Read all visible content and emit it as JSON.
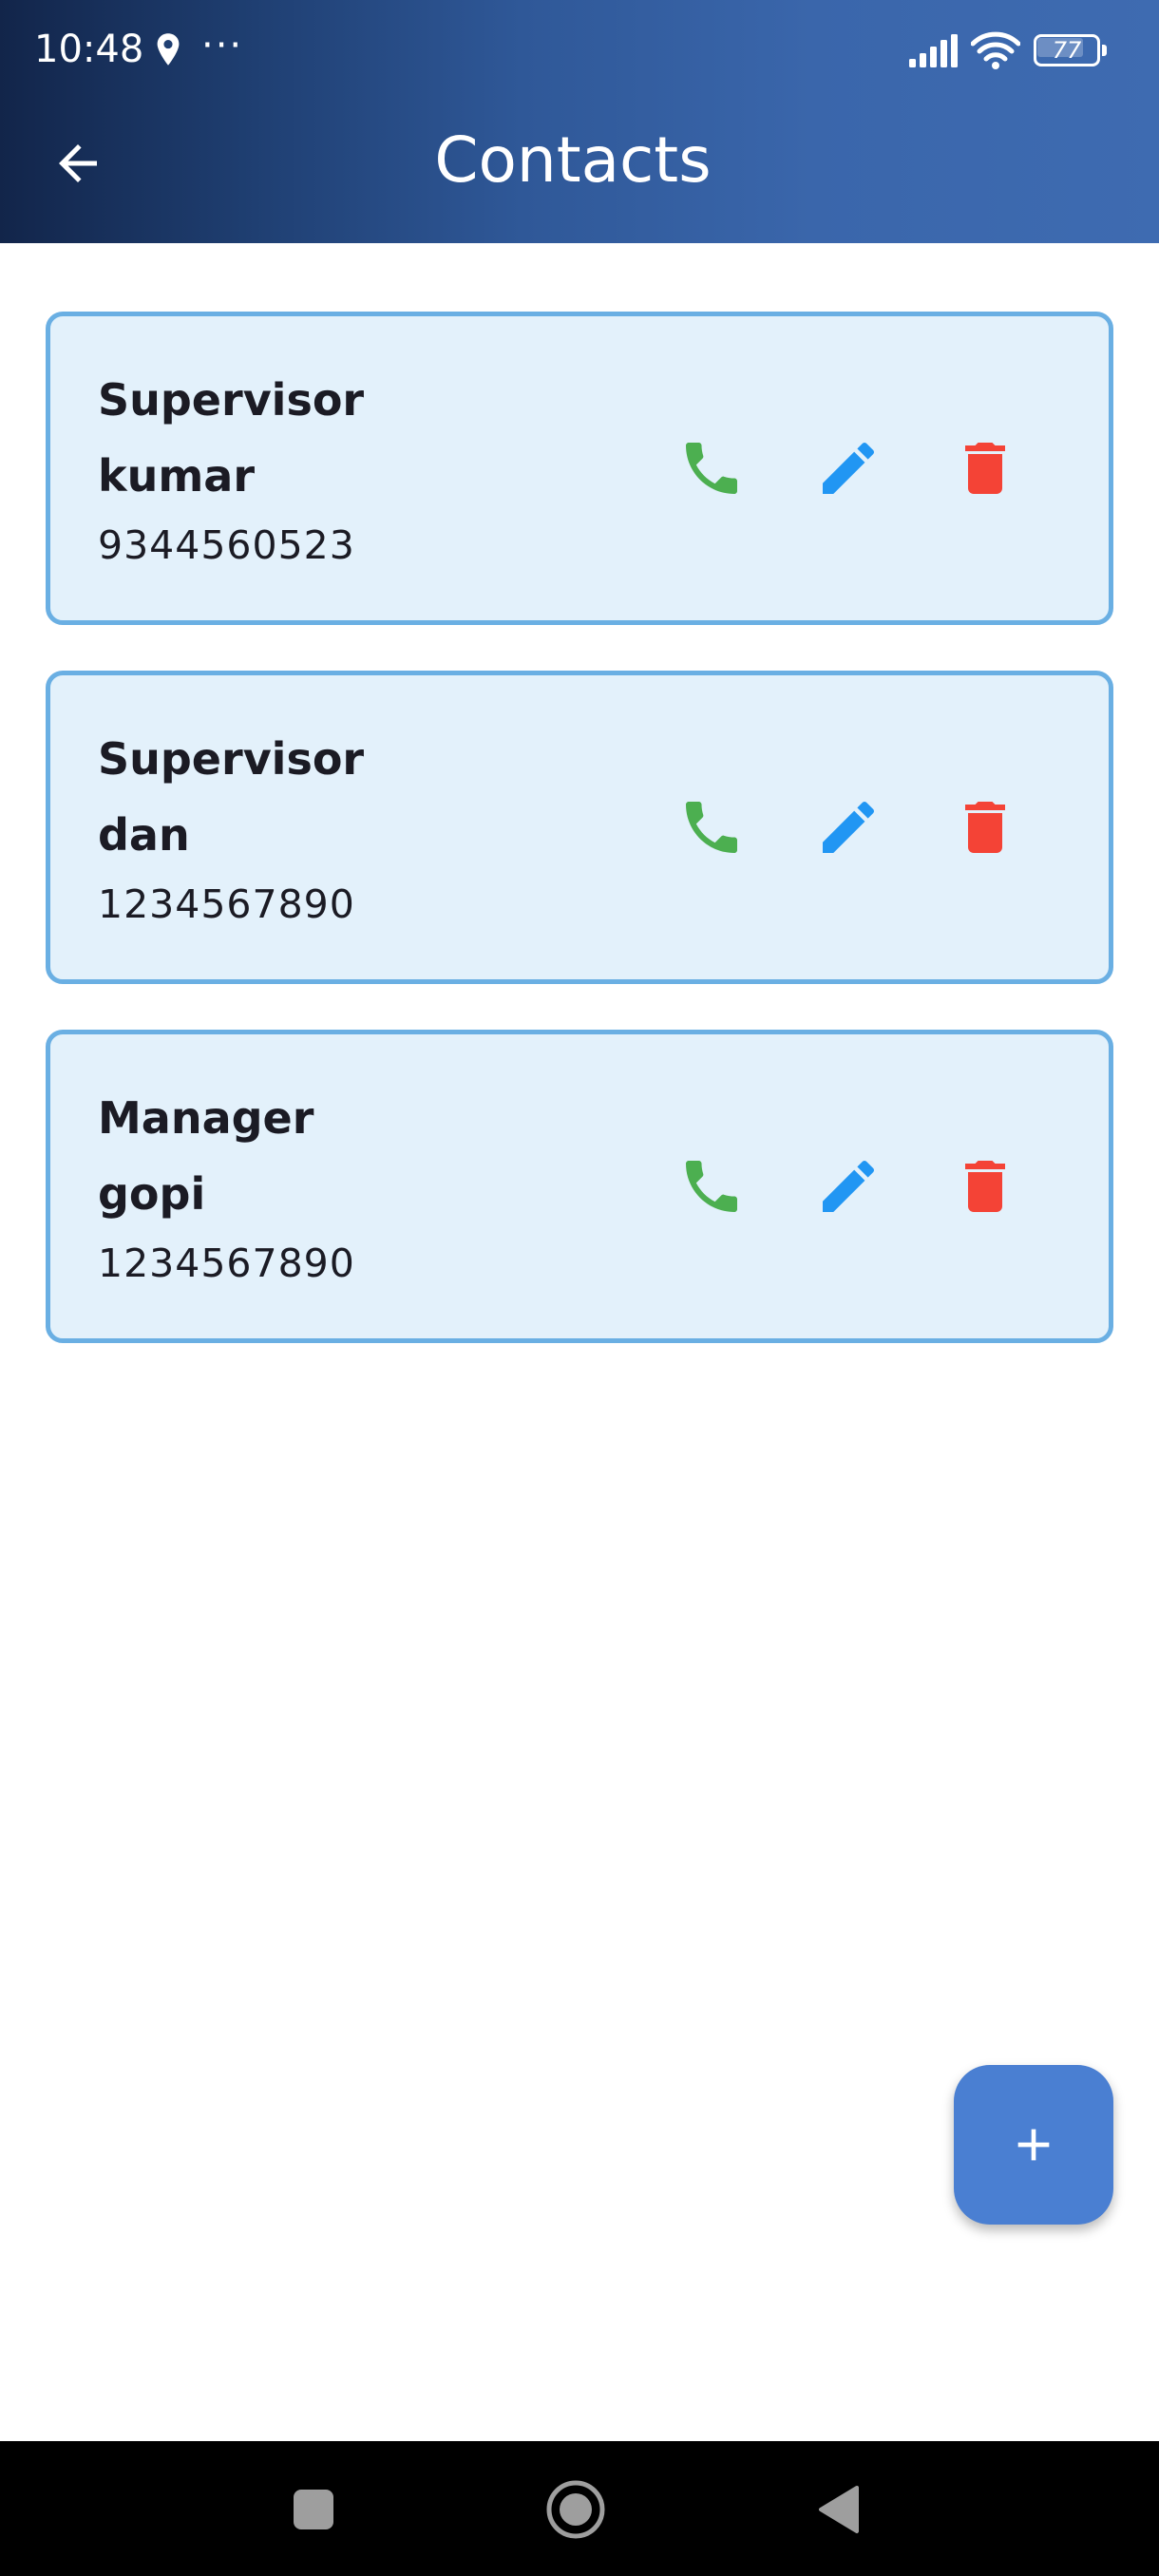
{
  "status_bar": {
    "time": "10:48",
    "more_indicator": "···",
    "battery_level": "77",
    "battery_fraction": 0.77,
    "icons": [
      "location-icon",
      "signal-icon",
      "wifi-icon",
      "battery-icon"
    ]
  },
  "toolbar": {
    "back_icon": "arrow-left-icon",
    "title": "Contacts"
  },
  "contacts": [
    {
      "role": "Supervisor",
      "name": "kumar",
      "phone": "9344560523"
    },
    {
      "role": "Supervisor",
      "name": "dan",
      "phone": "1234567890"
    },
    {
      "role": "Manager",
      "name": "gopi",
      "phone": "1234567890"
    }
  ],
  "card_actions": {
    "call_icon": "phone-icon",
    "edit_icon": "pencil-icon",
    "delete_icon": "trash-icon"
  },
  "fab": {
    "icon": "plus-icon"
  },
  "nav_bar": {
    "icons": [
      "recents-square-icon",
      "home-circle-icon",
      "back-triangle-icon"
    ]
  },
  "colors": {
    "header_gradient_start": "#12254a",
    "header_gradient_end": "#3e6bb1",
    "card_background": "#e3f1fb",
    "card_border": "#6aafe3",
    "call_green": "#4caf50",
    "edit_blue": "#2196f3",
    "delete_red": "#f44336",
    "fab_blue": "#4a7fd2"
  }
}
